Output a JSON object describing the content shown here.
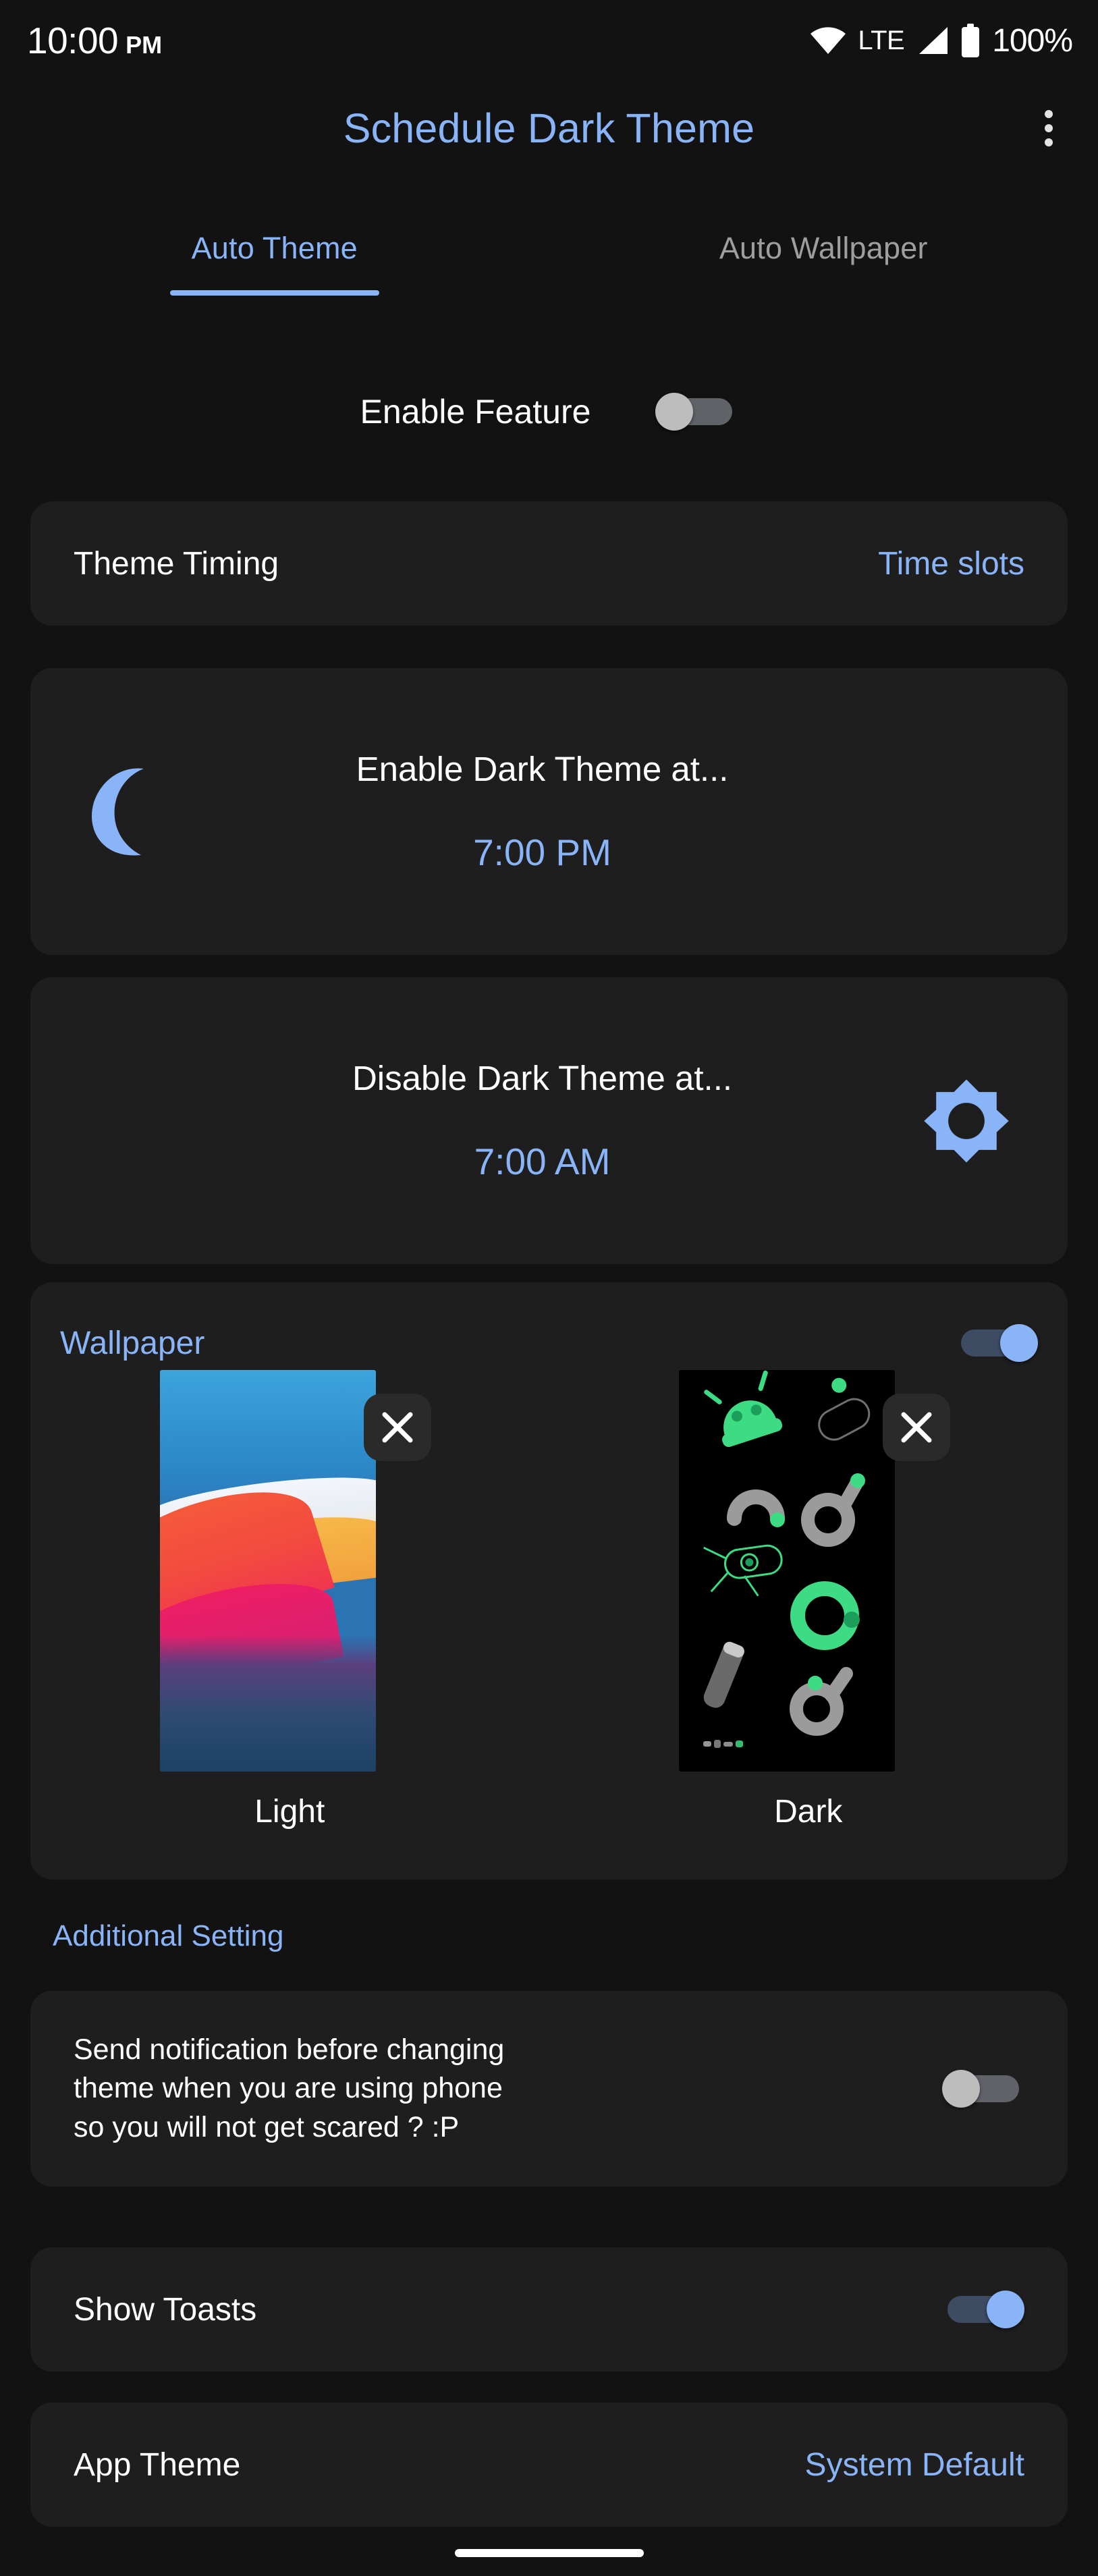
{
  "status_bar": {
    "time": "10:00",
    "am_pm": "PM",
    "network_label": "LTE",
    "battery_percent": "100%",
    "icons": [
      "wifi-icon",
      "cellular-signal-icon",
      "battery-icon"
    ]
  },
  "app_bar": {
    "title": "Schedule Dark Theme",
    "overflow_label": "more-options",
    "title_color": "#8ab4f8"
  },
  "tabs": [
    {
      "label": "Auto Theme",
      "active": true
    },
    {
      "label": "Auto Wallpaper",
      "active": false
    }
  ],
  "enable_feature": {
    "label": "Enable Feature",
    "toggle_state": "off"
  },
  "theme_timing": {
    "label": "Theme Timing",
    "value": "Time slots"
  },
  "schedule": [
    {
      "icon": "moon-icon",
      "icon_position": "left",
      "caption": "Enable Dark Theme at...",
      "time": "7:00 PM"
    },
    {
      "icon": "sun-brightness-icon",
      "icon_position": "right",
      "caption": "Disable Dark Theme at...",
      "time": "7:00 AM"
    }
  ],
  "wallpaper": {
    "title": "Wallpaper",
    "toggle_state": "on",
    "items": [
      {
        "label": "Light",
        "remove_label": "remove",
        "kind": "light-wallpaper-preview"
      },
      {
        "label": "Dark",
        "remove_label": "remove",
        "kind": "dark-wallpaper-preview"
      }
    ]
  },
  "additional_setting": {
    "section_label": "Additional Setting",
    "notification": {
      "text": "Send notification before changing\ntheme when you are using phone\nso you will not get scared ? :P",
      "toggle_state": "off"
    },
    "show_toasts": {
      "label": "Show Toasts",
      "toggle_state": "on"
    },
    "app_theme": {
      "label": "App Theme",
      "value": "System Default"
    }
  },
  "colors": {
    "background": "#121212",
    "card": "#1e1e1e",
    "accent": "#8ab4f8",
    "text_primary": "#ffffff",
    "text_secondary": "#9e9e9e",
    "switch_off_thumb": "#bdbdbd",
    "switch_off_track": "#5f6368"
  }
}
